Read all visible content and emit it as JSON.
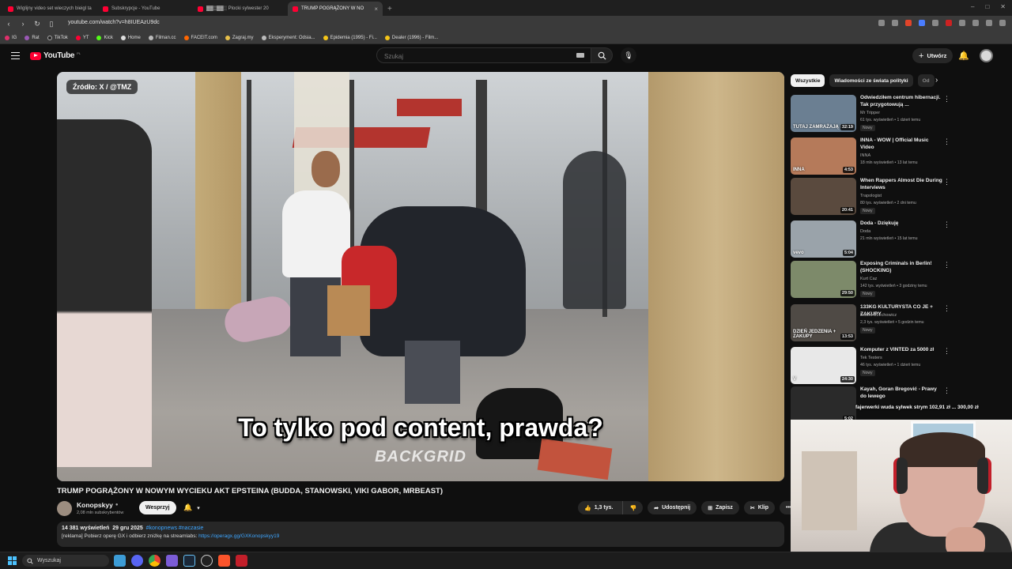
{
  "browser": {
    "tabs": [
      {
        "label": "Wiglijny video set wieczych bieigl ta",
        "active": false
      },
      {
        "label": "Subskrypcje - YouTube",
        "active": false
      },
      {
        "label": "▓▓▒▓▓░ Plocki sylwester 20",
        "active": false
      },
      {
        "label": "TRUMP POGRĄŻONY W NO",
        "active": true
      }
    ],
    "url": "youtube.com/watch?v=h8IUEAzU9dc",
    "bookmarks": [
      "IG",
      "Rat",
      "TikTok",
      "YT",
      "Kick",
      "Home",
      "Filman.cc",
      "FACEIT.com",
      "Zagraj.my",
      "Eksperyment: Odsia...",
      "Epidemia (1995) - Fi...",
      "Dealer (1996) - Film..."
    ]
  },
  "header": {
    "logo_text": "YouTube",
    "country_code": "PL",
    "search_placeholder": "Szukaj",
    "create_label": "Utwórz"
  },
  "video": {
    "source_badge": "Źródło: X / @TMZ",
    "subtitle": "To tylko pod content, prawda?",
    "watermark": "BACKGRID",
    "title": "TRUMP POGRĄŻONY W NOWYM WYCIEKU AKT EPSTEINA (BUDDA, STANOWSKI, VIKI GABOR, MRBEAST)"
  },
  "channel": {
    "name": "Konopskyy",
    "subscribers": "2,08 mln subskrybentów",
    "support_label": "Wesprzyj"
  },
  "actions": {
    "likes": "1,3 tys.",
    "share": "Udostępnij",
    "save": "Zapisz",
    "clip": "Klip"
  },
  "description": {
    "views": "14 381 wyświetleń",
    "date": "29 gru 2025",
    "tags": "#konopnews #naczasie",
    "line": "[reklama] Pobierz operę GX i odbierz zniżkę na streamlabs:",
    "link": "https://operagx.gg/GXKonopskyy19"
  },
  "sidebar": {
    "chips": [
      "Wszystkie",
      "Wiadomości ze świata polityki",
      "Od"
    ],
    "recommendations": [
      {
        "title": "Odwiedziłem centrum hibernacji. Tak przygotowują ...",
        "channel": "Mr Tripper",
        "meta": "61 tys. wyświetleń • 1 dzień temu",
        "badge": "Nowy",
        "duration": "32:19",
        "thumb_text": "TUTAJ ZAMRAŻAJĄ LUDZI",
        "thumb_color": "#6b7f92"
      },
      {
        "title": "INNA - WOW | Official Music Video",
        "channel": "INNA",
        "meta": "18 mln wyświetleń • 13 lat temu",
        "badge": "",
        "duration": "4:53",
        "thumb_text": "INNA",
        "thumb_color": "#b57a5a"
      },
      {
        "title": "When Rappers Almost Die During Interviews",
        "channel": "Trapologist",
        "meta": "80 tys. wyświetleń • 2 dni temu",
        "badge": "Nowy",
        "duration": "20:41",
        "thumb_text": "",
        "thumb_color": "#5a4a3e"
      },
      {
        "title": "Doda - Dziękuję",
        "channel": "Doda",
        "meta": "21 mln wyświetleń • 15 lat temu",
        "badge": "",
        "duration": "5:04",
        "thumb_text": "vevo",
        "thumb_color": "#9aa3aa"
      },
      {
        "title": "Exposing Criminals in Berlin! (SHOCKING)",
        "channel": "Kurt Caz",
        "meta": "142 tys. wyświetleń • 3 godziny temu",
        "badge": "Nowy",
        "duration": "29:50",
        "thumb_text": "",
        "thumb_color": "#7d8a6a"
      },
      {
        "title": "133KG KULTURYSTA CO JE + ZAKUPY",
        "channel": "Dawid Czechowicz",
        "meta": "2,3 tys. wyświetleń • 5 godzin temu",
        "badge": "Nowy",
        "duration": "13:53",
        "thumb_text": "DZIEŃ JEDZENIA + ZAKUPY",
        "thumb_color": "#4f4a45"
      },
      {
        "title": "Komputer z VINTED za 5000 zł",
        "channel": "Tek Testers",
        "meta": "46 tys. wyświetleń • 1 dzień temu",
        "badge": "Nowy",
        "duration": "24:30",
        "thumb_text": "V",
        "thumb_color": "#e8e8e8"
      },
      {
        "title": "Kayah, Goran Bregović - Prawy do lewego",
        "channel": "",
        "meta": "",
        "badge": "",
        "duration": "5:02",
        "thumb_text": "",
        "thumb_color": "#2a2a2a"
      }
    ]
  },
  "overlay": {
    "donation": "fajerwerki wuda sylwek strym  102,91 zł ... 300,00 zł"
  },
  "taskbar": {
    "search_label": "Wyszukaj"
  }
}
